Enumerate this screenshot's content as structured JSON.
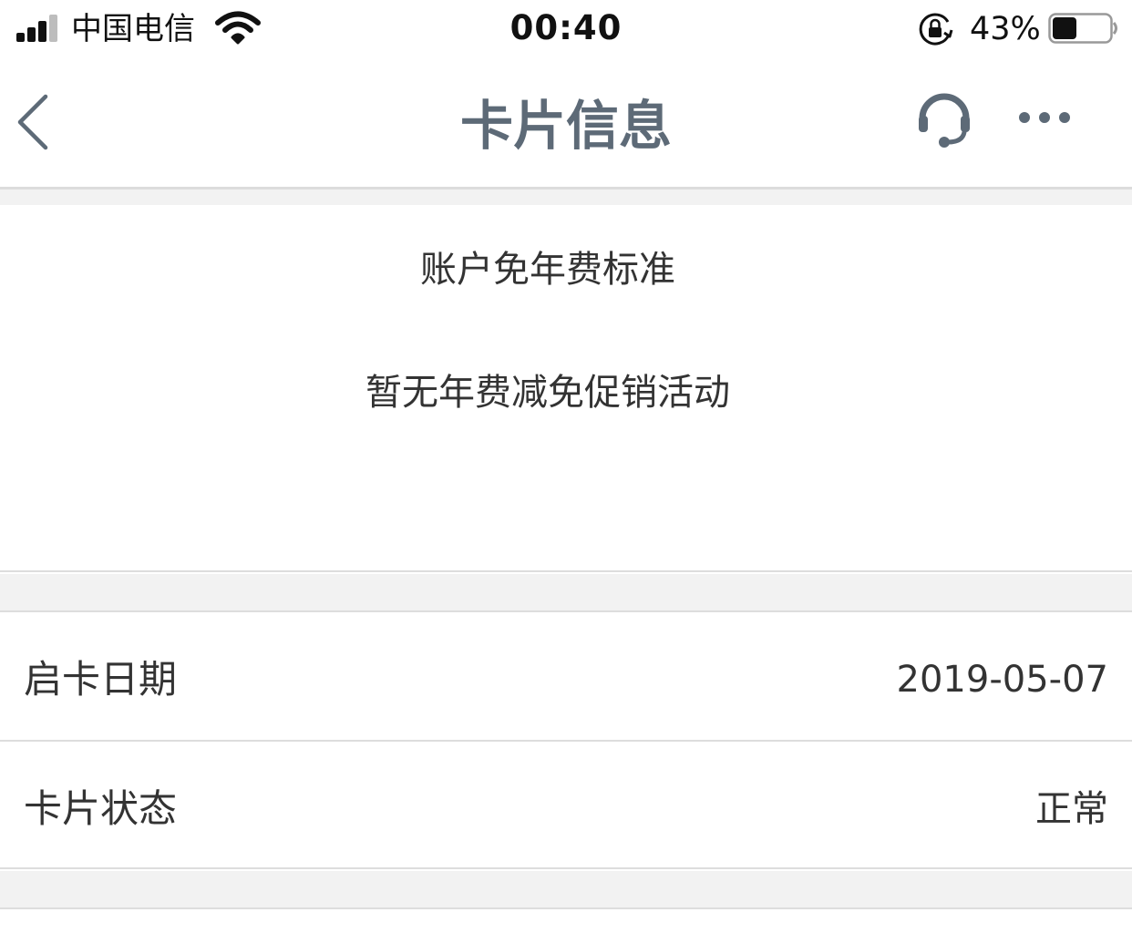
{
  "status_bar": {
    "carrier": "中国电信",
    "time": "00:40",
    "battery_percent": "43%",
    "battery_level": 0.43,
    "signal_bars_filled": 3,
    "signal_bars_total": 4,
    "icons": [
      "signal-icon",
      "wifi-icon",
      "rotation-lock-icon",
      "battery-icon"
    ]
  },
  "nav": {
    "title": "卡片信息",
    "title_color": "#5d6a77",
    "icons": [
      "back-chevron-icon",
      "headset-icon",
      "more-dots-icon"
    ]
  },
  "fee": {
    "title": "账户免年费标准",
    "description": "暂无年费减免促销活动"
  },
  "rows": [
    {
      "label": "启卡日期",
      "value": "2019-05-07"
    },
    {
      "label": "卡片状态",
      "value": "正常"
    }
  ],
  "colors": {
    "background": "#ffffff",
    "separator": "#f2f2f2",
    "text": "#333333"
  }
}
